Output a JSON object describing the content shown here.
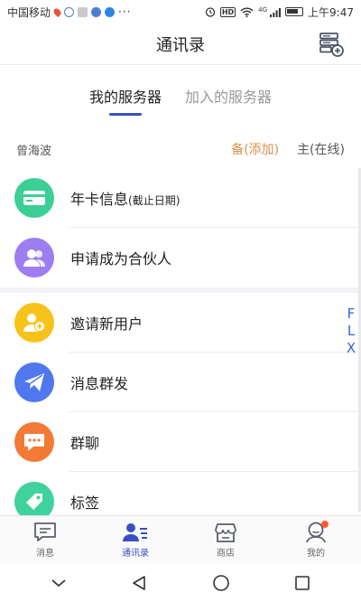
{
  "status_bar": {
    "carrier": "中国移动",
    "time": "上午9:47",
    "network": "4G",
    "hd": "HD"
  },
  "header": {
    "title": "通讯录"
  },
  "tabs": [
    {
      "label": "我的服务器",
      "active": true
    },
    {
      "label": "加入的服务器",
      "active": false
    }
  ],
  "owner_row": {
    "name": "曾海波",
    "backup_link": "备(添加)",
    "primary_link": "主(在线)"
  },
  "section_one": [
    {
      "label": "年卡信息",
      "sub": "(截止日期)",
      "icon": "card-icon",
      "color": "#3ccf95"
    },
    {
      "label": "申请成为合伙人",
      "sub": "",
      "icon": "partner-icon",
      "color": "#9d7ef0"
    }
  ],
  "section_two": [
    {
      "label": "邀请新用户",
      "icon": "invite-user-icon",
      "color": "#f7c31a"
    },
    {
      "label": "消息群发",
      "icon": "send-icon",
      "color": "#4f77ee"
    },
    {
      "label": "群聊",
      "icon": "group-chat-icon",
      "color": "#f37a34"
    },
    {
      "label": "标签",
      "icon": "tag-icon",
      "color": "#3fd29c"
    }
  ],
  "side_text": [
    "F",
    "L",
    "X"
  ],
  "bottom_nav": [
    {
      "label": "消息",
      "icon": "message-icon",
      "active": false
    },
    {
      "label": "通讯录",
      "icon": "contacts-icon",
      "active": true
    },
    {
      "label": "商店",
      "icon": "store-icon",
      "active": false
    },
    {
      "label": "我的",
      "icon": "profile-icon",
      "active": false
    }
  ],
  "colors": {
    "accent": "#3a4fc2",
    "link_orange": "#d8904a",
    "badge": "#ff5a2a"
  }
}
